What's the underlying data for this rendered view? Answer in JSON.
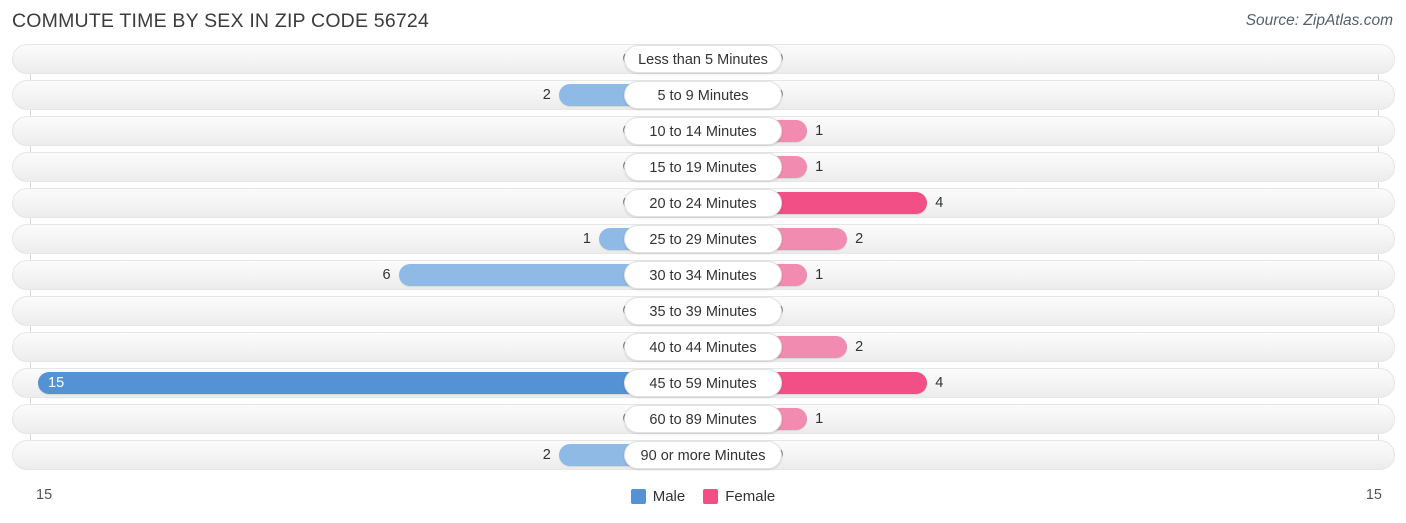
{
  "header": {
    "title": "COMMUTE TIME BY SEX IN ZIP CODE 56724",
    "source": "Source: ZipAtlas.com"
  },
  "legend": {
    "male_label": "Male",
    "female_label": "Female",
    "male_color": "#5492d6",
    "female_color": "#f24f86"
  },
  "axis": {
    "min_label": "15",
    "max_label": "15"
  },
  "chart_data": {
    "type": "bar",
    "orientation": "horizontal",
    "layout": "diverging-centered",
    "title": "COMMUTE TIME BY SEX IN ZIP CODE 56724",
    "xlabel": "",
    "ylabel": "",
    "xlim": [
      15,
      15
    ],
    "grid": true,
    "legend_position": "bottom-center",
    "categories": [
      "Less than 5 Minutes",
      "5 to 9 Minutes",
      "10 to 14 Minutes",
      "15 to 19 Minutes",
      "20 to 24 Minutes",
      "25 to 29 Minutes",
      "30 to 34 Minutes",
      "35 to 39 Minutes",
      "40 to 44 Minutes",
      "45 to 59 Minutes",
      "60 to 89 Minutes",
      "90 or more Minutes"
    ],
    "series": [
      {
        "name": "Male",
        "values": [
          0,
          2,
          0,
          0,
          0,
          1,
          6,
          0,
          0,
          15,
          0,
          2
        ]
      },
      {
        "name": "Female",
        "values": [
          0,
          0,
          1,
          1,
          4,
          2,
          1,
          0,
          2,
          4,
          1,
          0
        ]
      }
    ]
  },
  "rows": [
    {
      "label": "Less than 5 Minutes",
      "male": "0",
      "female": "0"
    },
    {
      "label": "5 to 9 Minutes",
      "male": "2",
      "female": "0"
    },
    {
      "label": "10 to 14 Minutes",
      "male": "0",
      "female": "1"
    },
    {
      "label": "15 to 19 Minutes",
      "male": "0",
      "female": "1"
    },
    {
      "label": "20 to 24 Minutes",
      "male": "0",
      "female": "4"
    },
    {
      "label": "25 to 29 Minutes",
      "male": "1",
      "female": "2"
    },
    {
      "label": "30 to 34 Minutes",
      "male": "6",
      "female": "1"
    },
    {
      "label": "35 to 39 Minutes",
      "male": "0",
      "female": "0"
    },
    {
      "label": "40 to 44 Minutes",
      "male": "0",
      "female": "2"
    },
    {
      "label": "45 to 59 Minutes",
      "male": "15",
      "female": "4"
    },
    {
      "label": "60 to 89 Minutes",
      "male": "0",
      "female": "1"
    },
    {
      "label": "90 or more Minutes",
      "male": "2",
      "female": "0"
    }
  ]
}
